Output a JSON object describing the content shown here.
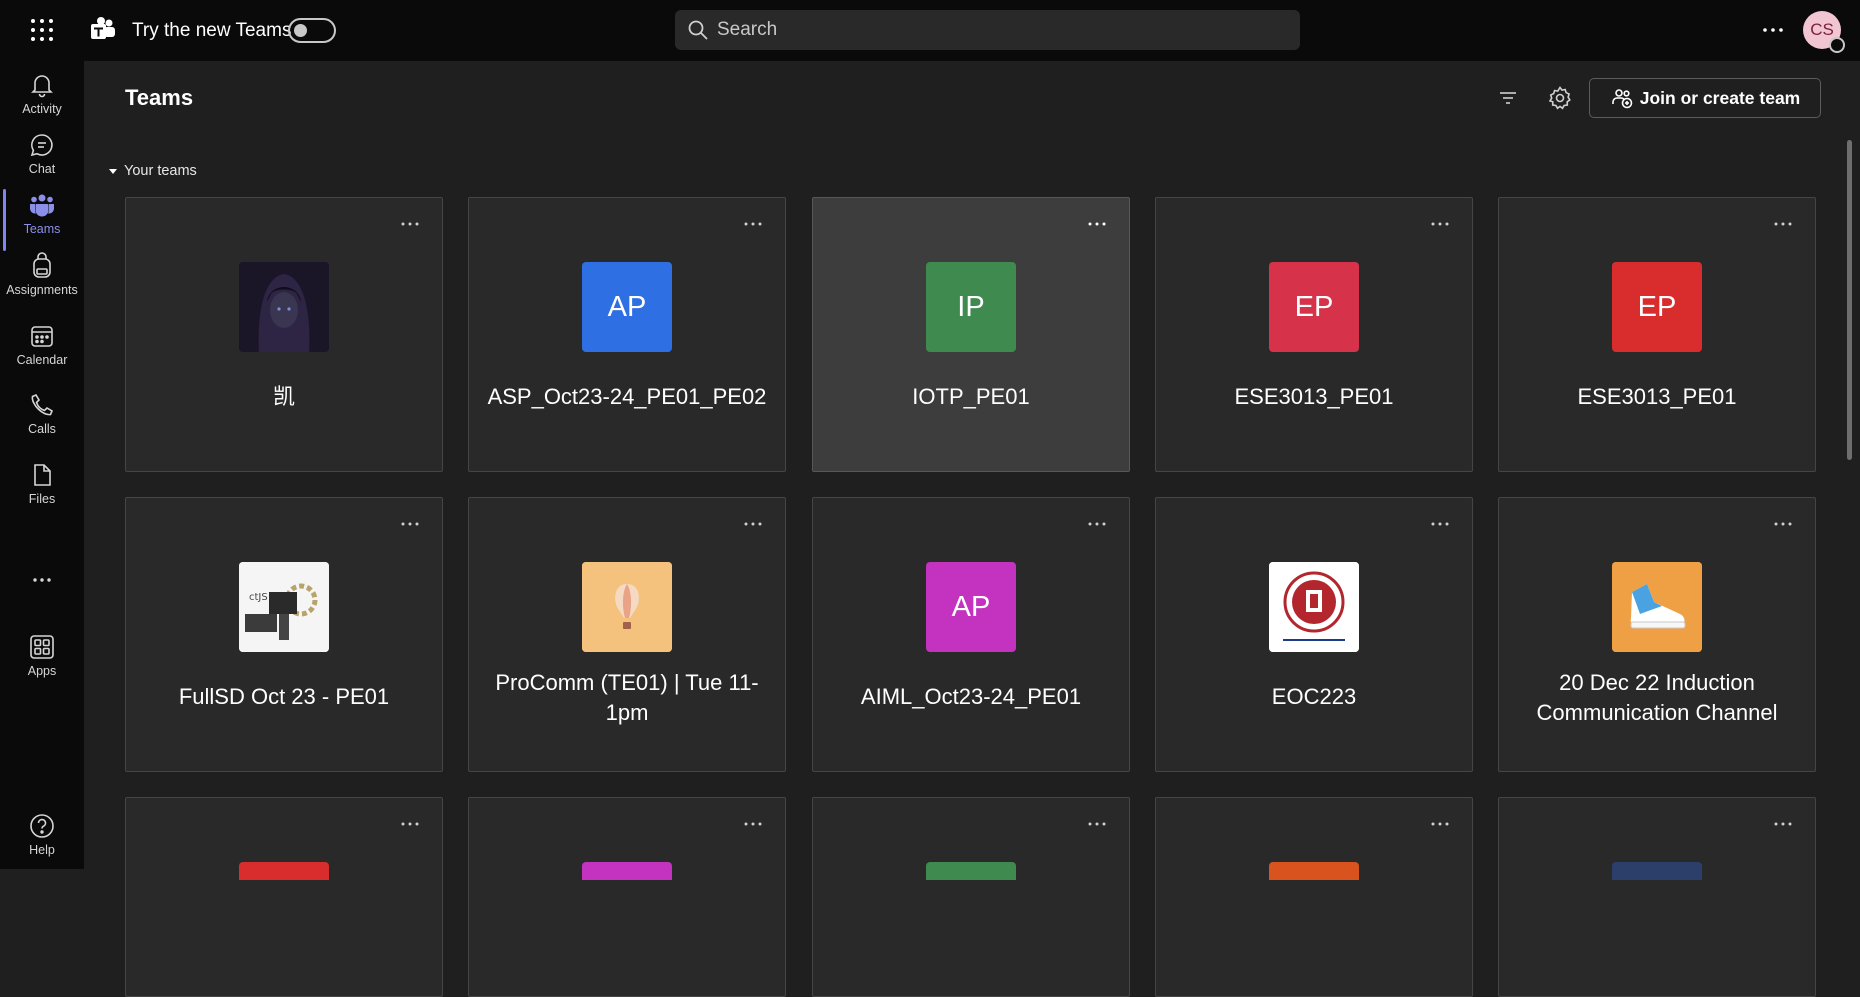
{
  "topbar": {
    "app_label": "Try the new Teams",
    "toggle_on": false,
    "search_placeholder": "Search",
    "avatar_initials": "CS"
  },
  "rail": {
    "items": [
      {
        "label": "Activity",
        "icon": "bell-icon"
      },
      {
        "label": "Chat",
        "icon": "chat-icon"
      },
      {
        "label": "Teams",
        "icon": "teams-icon",
        "active": true
      },
      {
        "label": "Assignments",
        "icon": "backpack-icon"
      },
      {
        "label": "Calendar",
        "icon": "calendar-icon"
      },
      {
        "label": "Calls",
        "icon": "phone-icon"
      },
      {
        "label": "Files",
        "icon": "file-icon"
      },
      {
        "label": "",
        "icon": "more-icon"
      },
      {
        "label": "Apps",
        "icon": "apps-icon"
      }
    ],
    "help_label": "Help"
  },
  "main": {
    "title": "Teams",
    "join_button": "Join or create team",
    "section_label": "Your teams",
    "teams": [
      {
        "name": "凯",
        "avatar": "",
        "color": "#2a2438",
        "kind": "photo"
      },
      {
        "name": "ASP_Oct23-24_PE01_PE02",
        "avatar": "AP",
        "color": "#2f6fe4",
        "kind": "initials"
      },
      {
        "name": "IOTP_PE01",
        "avatar": "IP",
        "color": "#3f8a4e",
        "kind": "initials"
      },
      {
        "name": "ESE3013_PE01",
        "avatar": "EP",
        "color": "#d6334a",
        "kind": "initials"
      },
      {
        "name": "ESE3013_PE01",
        "avatar": "EP",
        "color": "#d92d2d",
        "kind": "initials"
      },
      {
        "name": "FullSD Oct 23 - PE01",
        "avatar": "",
        "color": "#f5f5f5",
        "kind": "photo"
      },
      {
        "name": "ProComm (TE01) | Tue 11-1pm",
        "avatar": "",
        "color": "#f4c27d",
        "kind": "balloon"
      },
      {
        "name": "AIML_Oct23-24_PE01",
        "avatar": "AP",
        "color": "#c433c0",
        "kind": "initials"
      },
      {
        "name": "EOC223",
        "avatar": "",
        "color": "#ffffff",
        "kind": "seal"
      },
      {
        "name": "20 Dec 22 Induction Communication Channel",
        "avatar": "",
        "color": "#f0a044",
        "kind": "shoe"
      }
    ],
    "partial_row_colors": [
      "#d92d2d",
      "#c433c0",
      "#3f8a4e",
      "#d9531e",
      "#2c3e6a"
    ]
  }
}
